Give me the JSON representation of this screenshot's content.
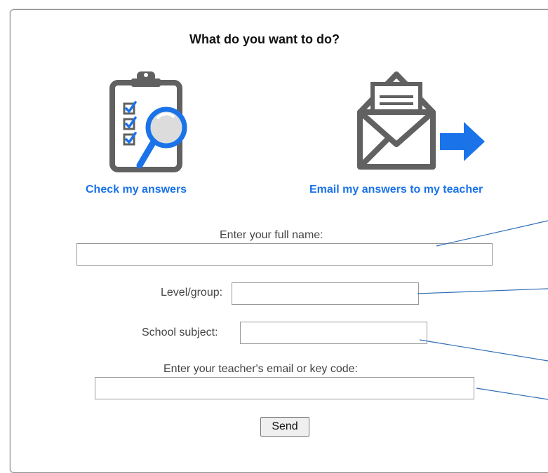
{
  "dialog": {
    "title": "What do you want to do?"
  },
  "options": {
    "check": {
      "label": "Check my answers",
      "icon": "clipboard-magnifier-icon"
    },
    "email": {
      "label": "Email my answers to my teacher",
      "icon": "envelope-arrow-icon"
    }
  },
  "form": {
    "full_name": {
      "label": "Enter your full name:",
      "value": ""
    },
    "level": {
      "label": "Level/group:",
      "value": ""
    },
    "subject": {
      "label": "School subject:",
      "value": ""
    },
    "teacher": {
      "label": "Enter your teacher's email or key code:",
      "value": ""
    },
    "send_label": "Send"
  },
  "colors": {
    "accent": "#1a73e8",
    "icon_gray": "#616161",
    "leader_line": "#2d6db5"
  }
}
